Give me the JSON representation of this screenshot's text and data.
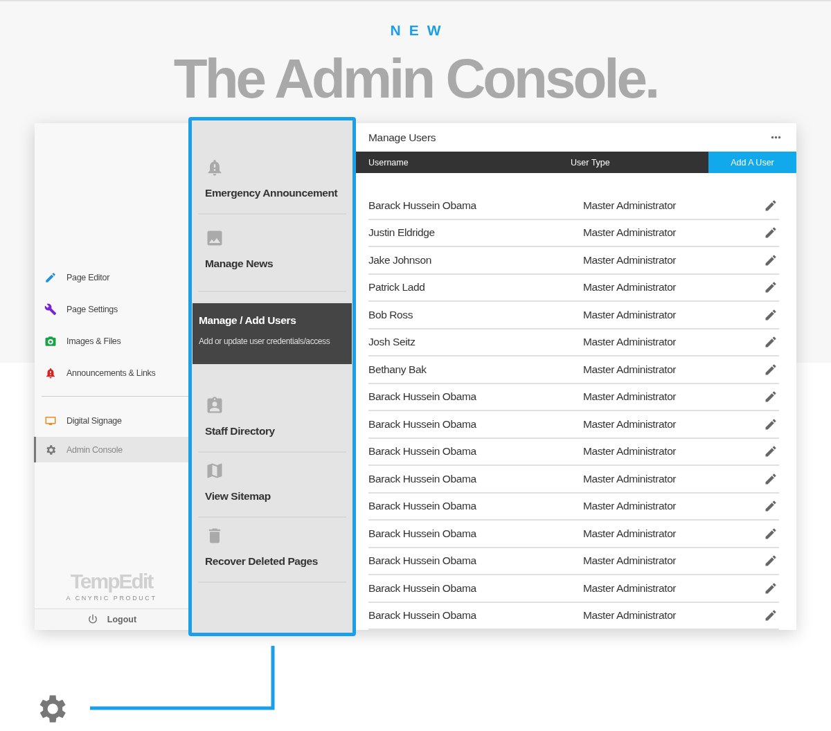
{
  "eyebrow": "NEW",
  "headline": "The Admin Console.",
  "sidebar": {
    "sections": [
      {
        "items": [
          {
            "label": "Page Editor",
            "kind": "pencil",
            "selected": false
          },
          {
            "label": "Page Settings",
            "kind": "wrench",
            "selected": false
          },
          {
            "label": "Images & Files",
            "kind": "camera",
            "selected": false
          },
          {
            "label": "Announcements & Links",
            "kind": "bell",
            "selected": false
          }
        ]
      },
      {
        "items": [
          {
            "label": "Digital Signage",
            "kind": "monitor",
            "selected": false
          },
          {
            "label": "Admin Console",
            "kind": "gear",
            "selected": true
          }
        ]
      }
    ],
    "logo": "TempEdit",
    "logo_tagline": "A CNYRIC PRODUCT",
    "logout": "Logout"
  },
  "admin_menu": [
    {
      "label": "Emergency Announcement",
      "kind": "bell",
      "selected": false
    },
    {
      "label": "Manage News",
      "kind": "image",
      "selected": false
    },
    {
      "label": "Manage / Add Users",
      "selected": true,
      "description": "Add or update user credentials/access"
    },
    {
      "label": "Staff Directory",
      "kind": "badge",
      "selected": false
    },
    {
      "label": "View Sitemap",
      "kind": "map",
      "selected": false
    },
    {
      "label": "Recover Deleted Pages",
      "kind": "trash",
      "selected": false
    }
  ],
  "panel": {
    "title": "Manage Users",
    "add_button": "Add A User",
    "columns": [
      "Username",
      "User Type"
    ],
    "rows": [
      {
        "username": "Barack Hussein Obama",
        "user_type": "Master Administrator"
      },
      {
        "username": "Justin Eldridge",
        "user_type": "Master Administrator"
      },
      {
        "username": "Jake Johnson",
        "user_type": "Master Administrator"
      },
      {
        "username": "Patrick Ladd",
        "user_type": "Master Administrator"
      },
      {
        "username": "Bob Ross",
        "user_type": "Master Administrator"
      },
      {
        "username": "Josh Seitz",
        "user_type": "Master Administrator"
      },
      {
        "username": "Bethany Bak",
        "user_type": "Master Administrator"
      },
      {
        "username": "Barack Hussein Obama",
        "user_type": "Master Administrator"
      },
      {
        "username": "Barack Hussein Obama",
        "user_type": "Master Administrator"
      },
      {
        "username": "Barack Hussein Obama",
        "user_type": "Master Administrator"
      },
      {
        "username": "Barack Hussein Obama",
        "user_type": "Master Administrator"
      },
      {
        "username": "Barack Hussein Obama",
        "user_type": "Master Administrator"
      },
      {
        "username": "Barack Hussein Obama",
        "user_type": "Master Administrator"
      },
      {
        "username": "Barack Hussein Obama",
        "user_type": "Master Administrator"
      },
      {
        "username": "Barack Hussein Obama",
        "user_type": "Master Administrator"
      },
      {
        "username": "Barack Hussein Obama",
        "user_type": "Master Administrator"
      }
    ]
  }
}
